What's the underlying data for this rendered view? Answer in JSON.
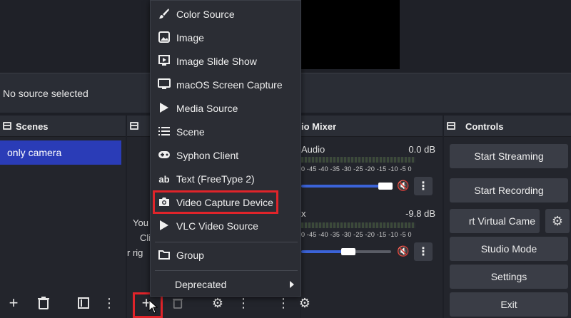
{
  "properties_bar": {
    "text": "No source selected"
  },
  "scenes": {
    "title": "Scenes",
    "items": [
      "only camera"
    ]
  },
  "sources": {
    "hint_lines": [
      "You",
      "Cli",
      "r rig"
    ]
  },
  "mixer": {
    "title": "io Mixer",
    "channels": [
      {
        "name": "Audio",
        "db": "0.0 dB",
        "volume_fraction": 1.0
      },
      {
        "name": "x",
        "db": "-9.8 dB",
        "volume_fraction": 0.55
      }
    ],
    "scale": "0 -45 -40 -35 -30 -25 -20 -15 -10 -5 0"
  },
  "controls": {
    "title": "Controls",
    "start_streaming": "Start Streaming",
    "start_recording": "Start Recording",
    "virtual_camera": "rt Virtual Came",
    "studio_mode": "Studio Mode",
    "settings": "Settings",
    "exit": "Exit"
  },
  "menu": {
    "items": [
      {
        "label": "Color Source",
        "icon": "brush-icon"
      },
      {
        "label": "Image",
        "icon": "image-icon"
      },
      {
        "label": "Image Slide Show",
        "icon": "slideshow-icon"
      },
      {
        "label": "macOS Screen Capture",
        "icon": "monitor-icon"
      },
      {
        "label": "Media Source",
        "icon": "play-icon"
      },
      {
        "label": "Scene",
        "icon": "list-icon"
      },
      {
        "label": "Syphon Client",
        "icon": "gamepad-icon"
      },
      {
        "label": "Text (FreeType 2)",
        "icon": "text-ab-icon"
      },
      {
        "label": "Video Capture Device",
        "icon": "camera-icon"
      },
      {
        "label": "VLC Video Source",
        "icon": "play-icon"
      },
      {
        "label": "Group",
        "icon": "folder-icon"
      },
      {
        "label": "Deprecated",
        "icon": "submenu-arrow-icon"
      }
    ]
  },
  "highlight_color": "#e0242a",
  "scene_selected_color": "#2a3cb7"
}
